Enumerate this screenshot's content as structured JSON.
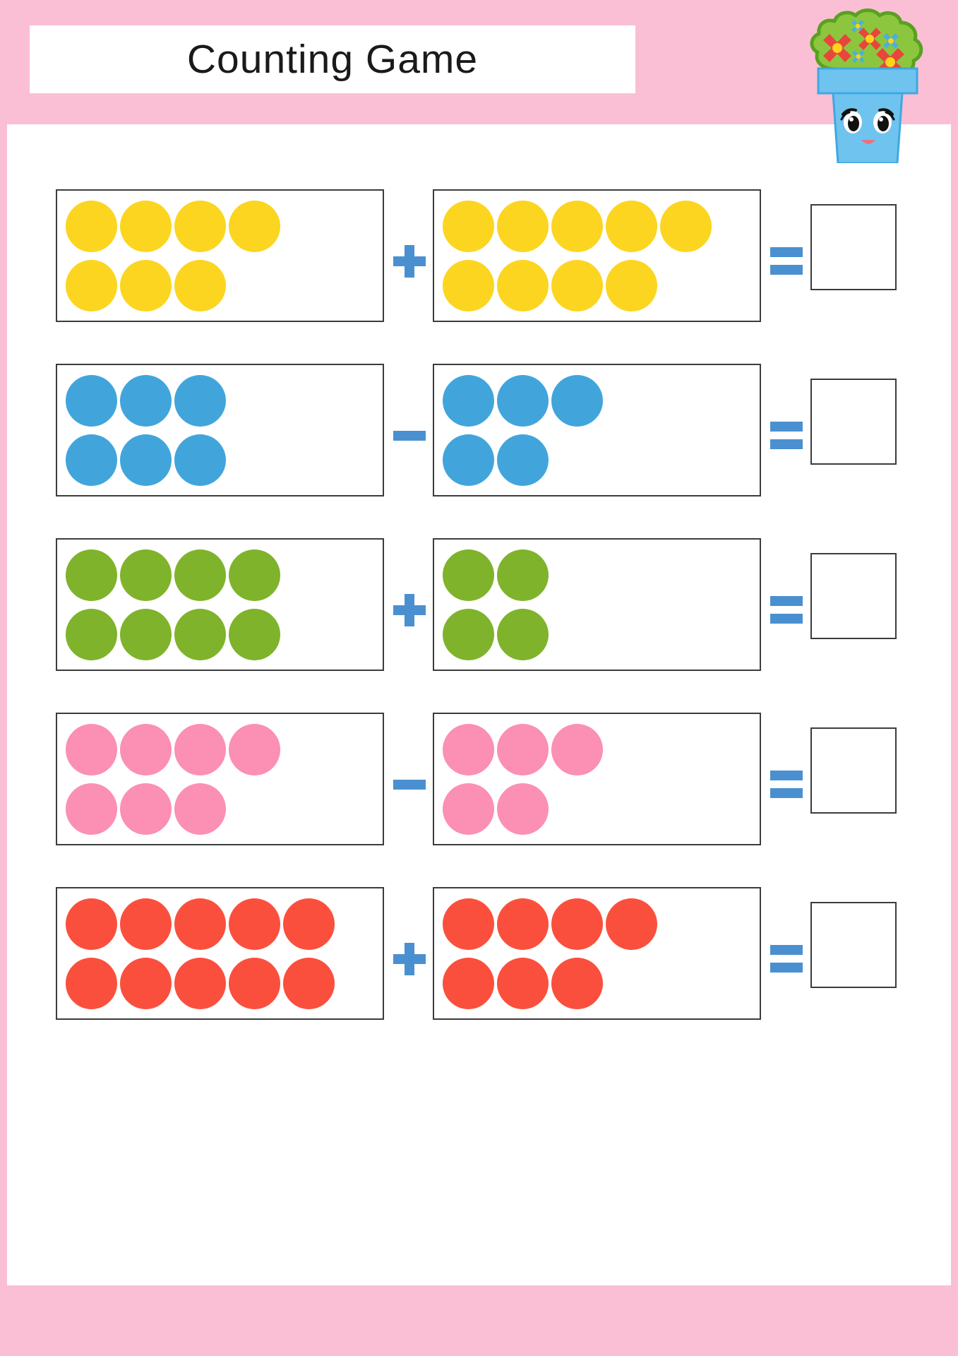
{
  "page": {
    "title": "Counting Game",
    "border_color": "#FBBFD5",
    "header_band_color": "#FBBFD5",
    "footer_band_color": "#FBBFD5",
    "background": "#ffffff"
  },
  "mascot": {
    "name": "flower-pot-character",
    "pot_color": "#6FC3EF",
    "pot_rim_color": "#6FC3EF",
    "bush_color": "#8CC63F",
    "bush_outline": "#5AA021",
    "flower_red": "#E8453C",
    "flower_blue": "#4AAFE0",
    "flower_center": "#FFD21E",
    "eye_color": "#111111",
    "mouth_color": "#E8717F"
  },
  "symbols": {
    "plus": "+",
    "minus": "−",
    "equals": "=",
    "operator_color": "#4A90D0",
    "box_border_color": "#3c3c3c"
  },
  "answer": {
    "value": "",
    "placeholder": ""
  },
  "chart_data": {
    "type": "table",
    "title": "Counting Game",
    "description": "Five addition/subtraction counting exercises using colored dot groups",
    "columns": [
      "left_count",
      "operator",
      "right_count",
      "equals",
      "answer"
    ],
    "rows": [
      {
        "left_count": 7,
        "operator": "+",
        "right_count": 9,
        "answer": ""
      },
      {
        "left_count": 6,
        "operator": "−",
        "right_count": 5,
        "answer": ""
      },
      {
        "left_count": 8,
        "operator": "+",
        "right_count": 4,
        "answer": ""
      },
      {
        "left_count": 7,
        "operator": "−",
        "right_count": 5,
        "answer": ""
      },
      {
        "left_count": 10,
        "operator": "+",
        "right_count": 7,
        "answer": ""
      }
    ]
  },
  "exercises": [
    {
      "id": "exercise-1",
      "color": "#FCD520",
      "color_name": "yellow",
      "operator": "+",
      "operator_type": "plus",
      "left": {
        "rows": [
          4,
          3
        ],
        "total": 7
      },
      "right": {
        "rows": [
          5,
          4
        ],
        "total": 9
      },
      "answer": ""
    },
    {
      "id": "exercise-2",
      "color": "#41A5DC",
      "color_name": "blue",
      "operator": "−",
      "operator_type": "minus",
      "left": {
        "rows": [
          3,
          3
        ],
        "total": 6
      },
      "right": {
        "rows": [
          3,
          2
        ],
        "total": 5
      },
      "answer": ""
    },
    {
      "id": "exercise-3",
      "color": "#7FB32B",
      "color_name": "green",
      "operator": "+",
      "operator_type": "plus",
      "left": {
        "rows": [
          4,
          4
        ],
        "total": 8
      },
      "right": {
        "rows": [
          2,
          2
        ],
        "total": 4
      },
      "answer": ""
    },
    {
      "id": "exercise-4",
      "color": "#FB8FB4",
      "color_name": "pink",
      "operator": "−",
      "operator_type": "minus",
      "left": {
        "rows": [
          4,
          3
        ],
        "total": 7
      },
      "right": {
        "rows": [
          3,
          2
        ],
        "total": 5
      },
      "answer": ""
    },
    {
      "id": "exercise-5",
      "color": "#FB4F3D",
      "color_name": "red",
      "operator": "+",
      "operator_type": "plus",
      "left": {
        "rows": [
          5,
          5
        ],
        "total": 10
      },
      "right": {
        "rows": [
          4,
          3
        ],
        "total": 7
      },
      "answer": ""
    }
  ]
}
